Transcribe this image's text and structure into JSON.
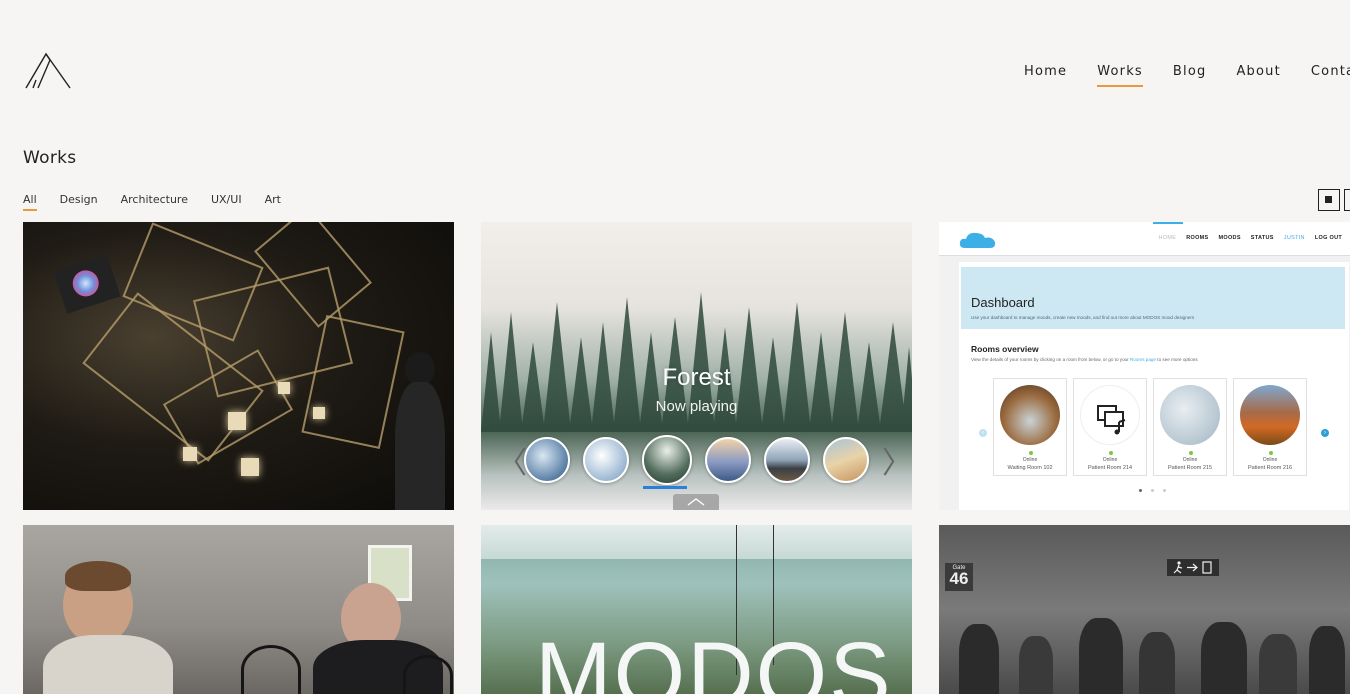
{
  "header": {
    "logo_icon": "abstract-a-logo",
    "nav": [
      {
        "label": "Home",
        "active": false
      },
      {
        "label": "Works",
        "active": true
      },
      {
        "label": "Blog",
        "active": false
      },
      {
        "label": "About",
        "active": false
      },
      {
        "label": "Contac",
        "active": false
      }
    ]
  },
  "page": {
    "title": "Works",
    "filters": [
      {
        "label": "All",
        "active": true
      },
      {
        "label": "Design",
        "active": false
      },
      {
        "label": "Architecture",
        "active": false
      },
      {
        "label": "UX/UI",
        "active": false
      },
      {
        "label": "Art",
        "active": false
      }
    ],
    "view_toggle_icons": [
      "grid-large-view-icon",
      "grid-list-view-icon"
    ]
  },
  "colors": {
    "background": "#f6f5f3",
    "accent_underline": "#e89a3c",
    "carousel_select": "#2c7fd6",
    "dashboard_blue": "#3cb0e6"
  },
  "tiles": {
    "forest": {
      "title": "Forest",
      "subtitle": "Now playing",
      "prev_icon": "chevron-left-icon",
      "next_icon": "chevron-right-icon",
      "drawer_icon": "chevron-up-icon"
    },
    "dashboard": {
      "nav": [
        "HOME",
        "ROOMS",
        "MOODS",
        "STATUS",
        "JUSTIN",
        "LOG OUT"
      ],
      "title": "Dashboard",
      "subtitle": "Use your dashboard to manage moods, create new moods, and find out more about MODOS mood designers",
      "rooms_title": "Rooms overview",
      "rooms_sub_before": "View the details of your rooms by clicking on a room from below, or go to your ",
      "rooms_sub_link": "Rooms page",
      "rooms_sub_after": " to see more options",
      "rooms": [
        {
          "status": "Online",
          "name": "Waiting Room 102"
        },
        {
          "status": "Online",
          "name": "Patient Room 214"
        },
        {
          "status": "Online",
          "name": "Patient Room 215"
        },
        {
          "status": "Online",
          "name": "Patient Room 216"
        }
      ]
    },
    "modos": {
      "text": "MODOS"
    },
    "airport": {
      "gate_small": "Gate",
      "gate_number": "46"
    }
  }
}
